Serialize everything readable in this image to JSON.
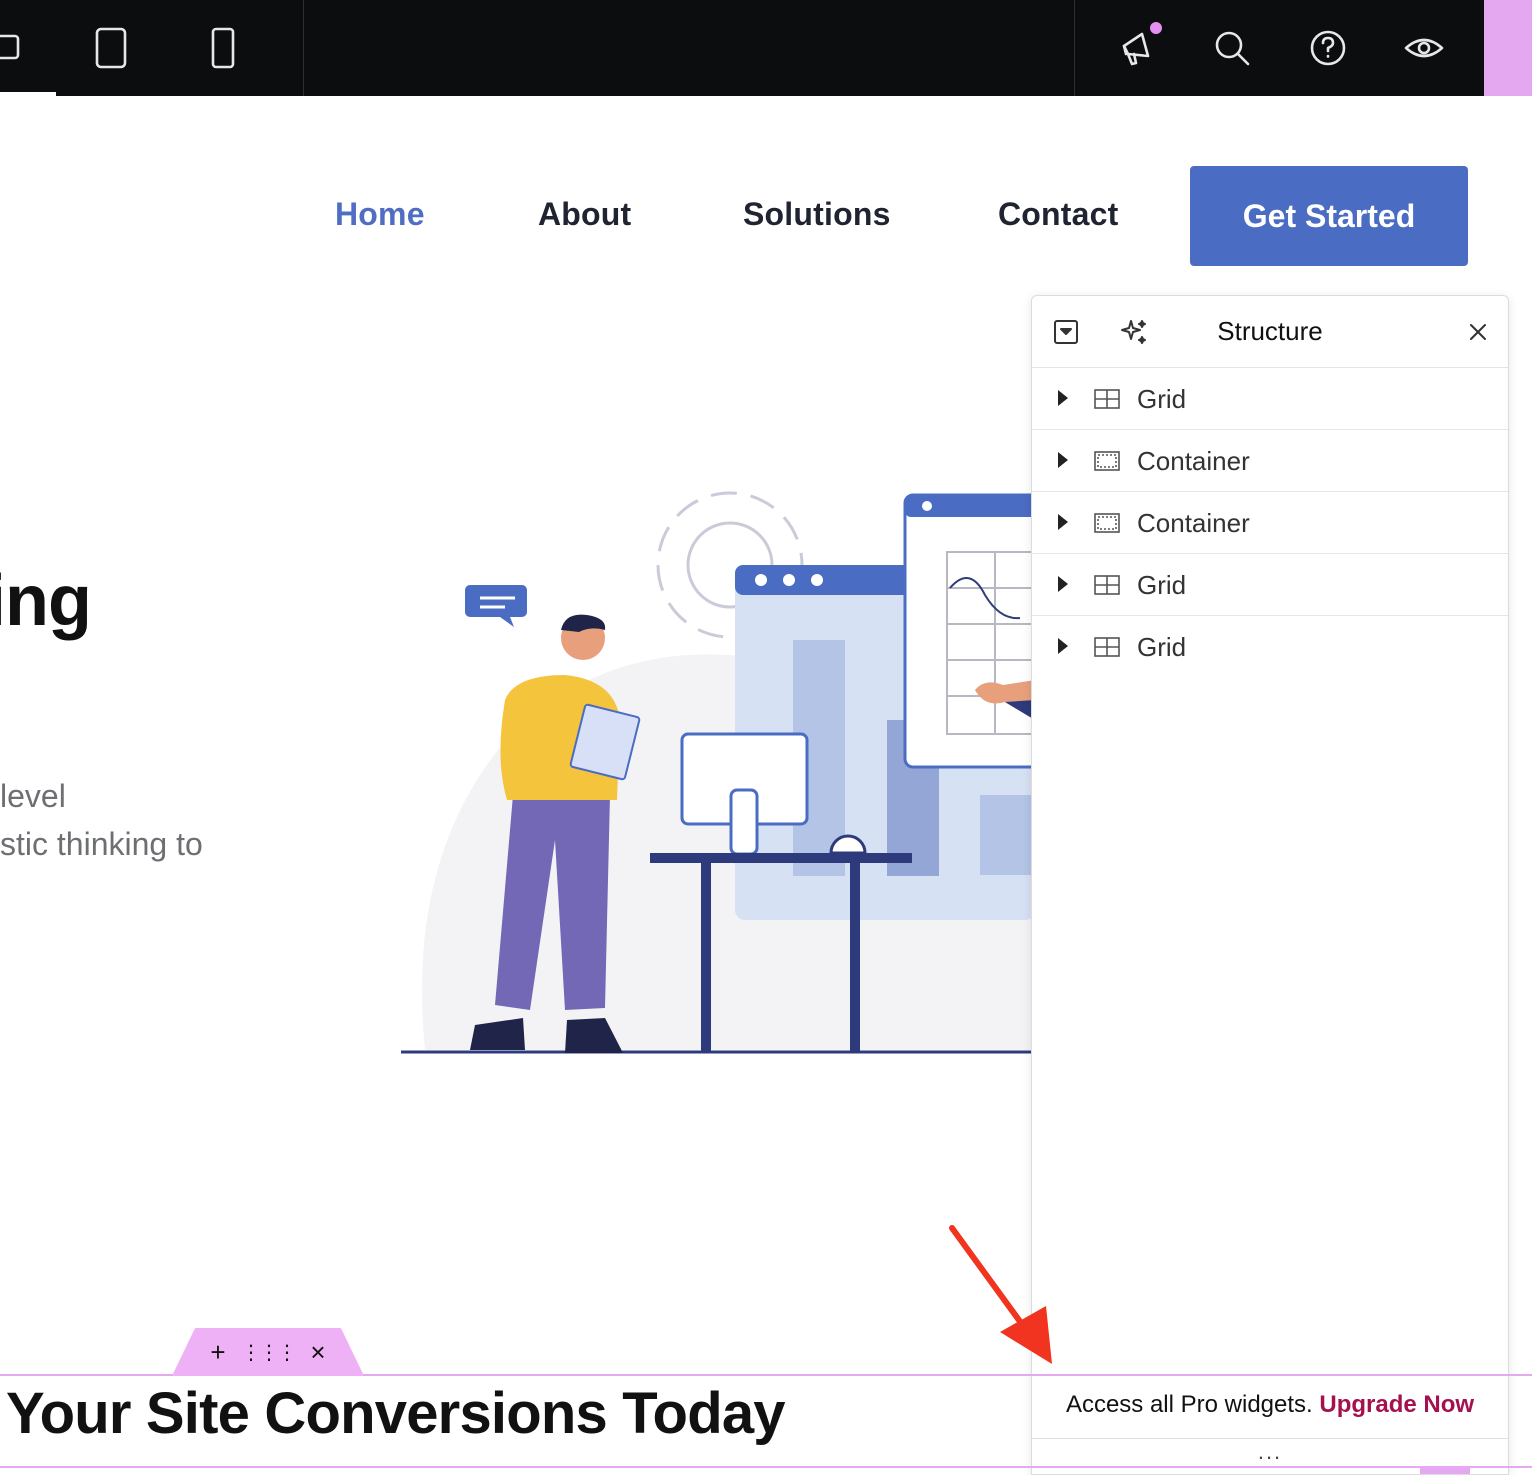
{
  "toolbar": {
    "icons": [
      "desktop-icon",
      "tablet-icon",
      "mobile-icon",
      "megaphone-icon",
      "search-icon",
      "help-icon",
      "eye-icon"
    ]
  },
  "nav": {
    "items": [
      {
        "label": "Home",
        "active": true
      },
      {
        "label": "About",
        "active": false
      },
      {
        "label": "Solutions",
        "active": false
      },
      {
        "label": "Contact",
        "active": false
      }
    ],
    "cta_label": "Get Started"
  },
  "hero": {
    "title_fragment": "ing",
    "text_line_1": "level",
    "text_line_2": "stic thinking to"
  },
  "section": {
    "heading": "Your Site Conversions Today"
  },
  "structure_panel": {
    "title": "Structure",
    "items": [
      {
        "label": "Grid",
        "type": "grid"
      },
      {
        "label": "Container",
        "type": "container"
      },
      {
        "label": "Container",
        "type": "container"
      },
      {
        "label": "Grid",
        "type": "grid"
      },
      {
        "label": "Grid",
        "type": "grid"
      }
    ],
    "footer_text": "Access all Pro widgets.",
    "footer_link": "Upgrade Now",
    "more": "..."
  },
  "colors": {
    "accent": "#4b6cc3",
    "nav_active": "#4f6dc2",
    "upgrade_link": "#a4114e",
    "section_outline": "#e6a9f1"
  }
}
